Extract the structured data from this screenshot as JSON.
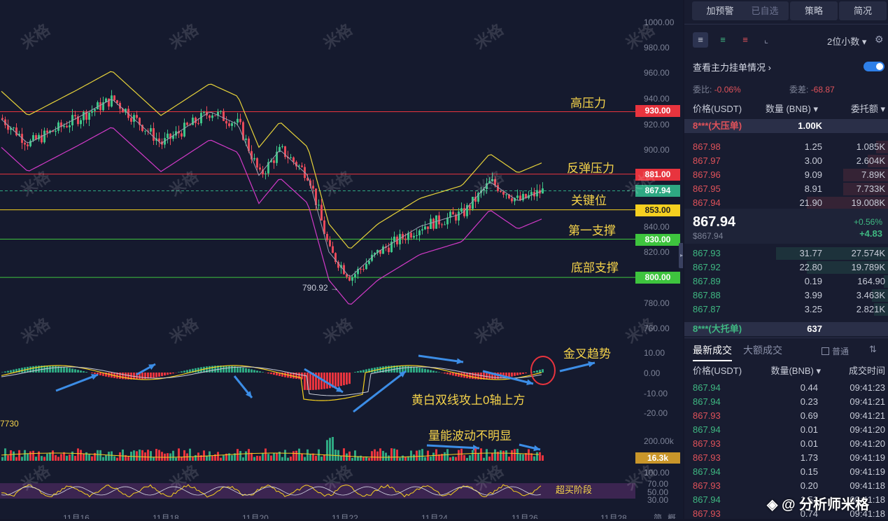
{
  "chart": {
    "y_axis_ticks": [
      "1000.00",
      "980.00",
      "960.00",
      "940.00",
      "920.00",
      "900.00",
      "880.00",
      "860.00",
      "840.00",
      "820.00",
      "800.00",
      "780.00",
      "760.00"
    ],
    "price_levels": [
      {
        "value": "930.00",
        "color": "#e8343e",
        "label": "高压力",
        "kind": "resistance"
      },
      {
        "value": "881.00",
        "color": "#e8343e",
        "label": "反弹压力",
        "kind": "resistance"
      },
      {
        "value": "867.94",
        "color": "#2ea882",
        "label": "",
        "kind": "current"
      },
      {
        "value": "853.00",
        "color": "#f5d020",
        "label": "关键位",
        "kind": "key"
      },
      {
        "value": "830.00",
        "color": "#3ec43e",
        "label": "第一支撑",
        "kind": "support"
      },
      {
        "value": "800.00",
        "color": "#3ec43e",
        "label": "底部支撑",
        "kind": "support"
      }
    ],
    "low_marker": "790.92 →",
    "macd_ticks": [
      "10.00",
      "0.00",
      "-10.00",
      "-20.00"
    ],
    "macd_annotation": "金叉趋势",
    "macd_note": "黄白双线攻上0轴上方",
    "volume_left_label": "7730",
    "volume_ticks": [
      "200.00k"
    ],
    "volume_current": "16.3k",
    "volume_note": "量能波动不明显",
    "rsi_ticks": [
      "100.00",
      "70.00",
      "50.00",
      "30.00"
    ],
    "rsi_note": "超买阶段",
    "dates": [
      "11月16",
      "11月18",
      "11月20",
      "11月22",
      "11月24",
      "11月26",
      "11月28"
    ],
    "right_corner_labels": [
      "简",
      "概"
    ],
    "watermark": "米格",
    "footer_credit": "分析师米格"
  },
  "panel": {
    "top_buttons": [
      "加预警",
      "已自选",
      "策略",
      "简况"
    ],
    "decimal_select": "2位小数",
    "orderbook_toggle_label": "查看主力挂单情况",
    "ratio_label": "委比:",
    "ratio_value": "-0.06%",
    "diff_label": "委差:",
    "diff_value": "-68.87",
    "book_headers": [
      "价格(USDT)",
      "数量 (BNB)",
      "委托额"
    ],
    "big_ask": {
      "label": "8***(大压单)",
      "value": "1.00K"
    },
    "asks": [
      {
        "price": "867.98",
        "qty": "1.25",
        "amount": "1.085K",
        "depth": 0.06
      },
      {
        "price": "867.97",
        "qty": "3.00",
        "amount": "2.604K",
        "depth": 0.1
      },
      {
        "price": "867.96",
        "qty": "9.09",
        "amount": "7.89K",
        "depth": 0.22
      },
      {
        "price": "867.95",
        "qty": "8.91",
        "amount": "7.733K",
        "depth": 0.22
      },
      {
        "price": "867.94",
        "qty": "21.90",
        "amount": "19.008K",
        "depth": 0.4
      }
    ],
    "last_price": "867.94",
    "last_price_usd": "$867.94",
    "change_pct": "+0.56%",
    "change_abs": "+4.83",
    "bids": [
      {
        "price": "867.93",
        "qty": "31.77",
        "amount": "27.574K",
        "depth": 0.55
      },
      {
        "price": "867.92",
        "qty": "22.80",
        "amount": "19.789K",
        "depth": 0.4
      },
      {
        "price": "867.89",
        "qty": "0.19",
        "amount": "164.90",
        "depth": 0.02
      },
      {
        "price": "867.88",
        "qty": "3.99",
        "amount": "3.463K",
        "depth": 0.08
      },
      {
        "price": "867.87",
        "qty": "3.25",
        "amount": "2.821K",
        "depth": 0.07
      }
    ],
    "big_bid": {
      "label": "8***(大托单)",
      "value": "637"
    },
    "trade_tabs": [
      "最新成交",
      "大额成交"
    ],
    "trade_filter": "普通",
    "trade_headers": [
      "价格(USDT)",
      "数量(BNB)",
      "成交时间"
    ],
    "trades": [
      {
        "price": "867.94",
        "qty": "0.44",
        "time": "09:41:23",
        "side": "buy"
      },
      {
        "price": "867.94",
        "qty": "0.23",
        "time": "09:41:21",
        "side": "buy"
      },
      {
        "price": "867.93",
        "qty": "0.69",
        "time": "09:41:21",
        "side": "sell"
      },
      {
        "price": "867.94",
        "qty": "0.01",
        "time": "09:41:20",
        "side": "buy"
      },
      {
        "price": "867.93",
        "qty": "0.01",
        "time": "09:41:20",
        "side": "sell"
      },
      {
        "price": "867.93",
        "qty": "1.73",
        "time": "09:41:19",
        "side": "sell"
      },
      {
        "price": "867.94",
        "qty": "0.15",
        "time": "09:41:19",
        "side": "buy"
      },
      {
        "price": "867.93",
        "qty": "0.20",
        "time": "09:41:18",
        "side": "sell"
      },
      {
        "price": "867.94",
        "qty": "1.51",
        "time": "09:41:18",
        "side": "buy"
      },
      {
        "price": "867.93",
        "qty": "0.74",
        "time": "09:41:18",
        "side": "sell"
      }
    ]
  }
}
